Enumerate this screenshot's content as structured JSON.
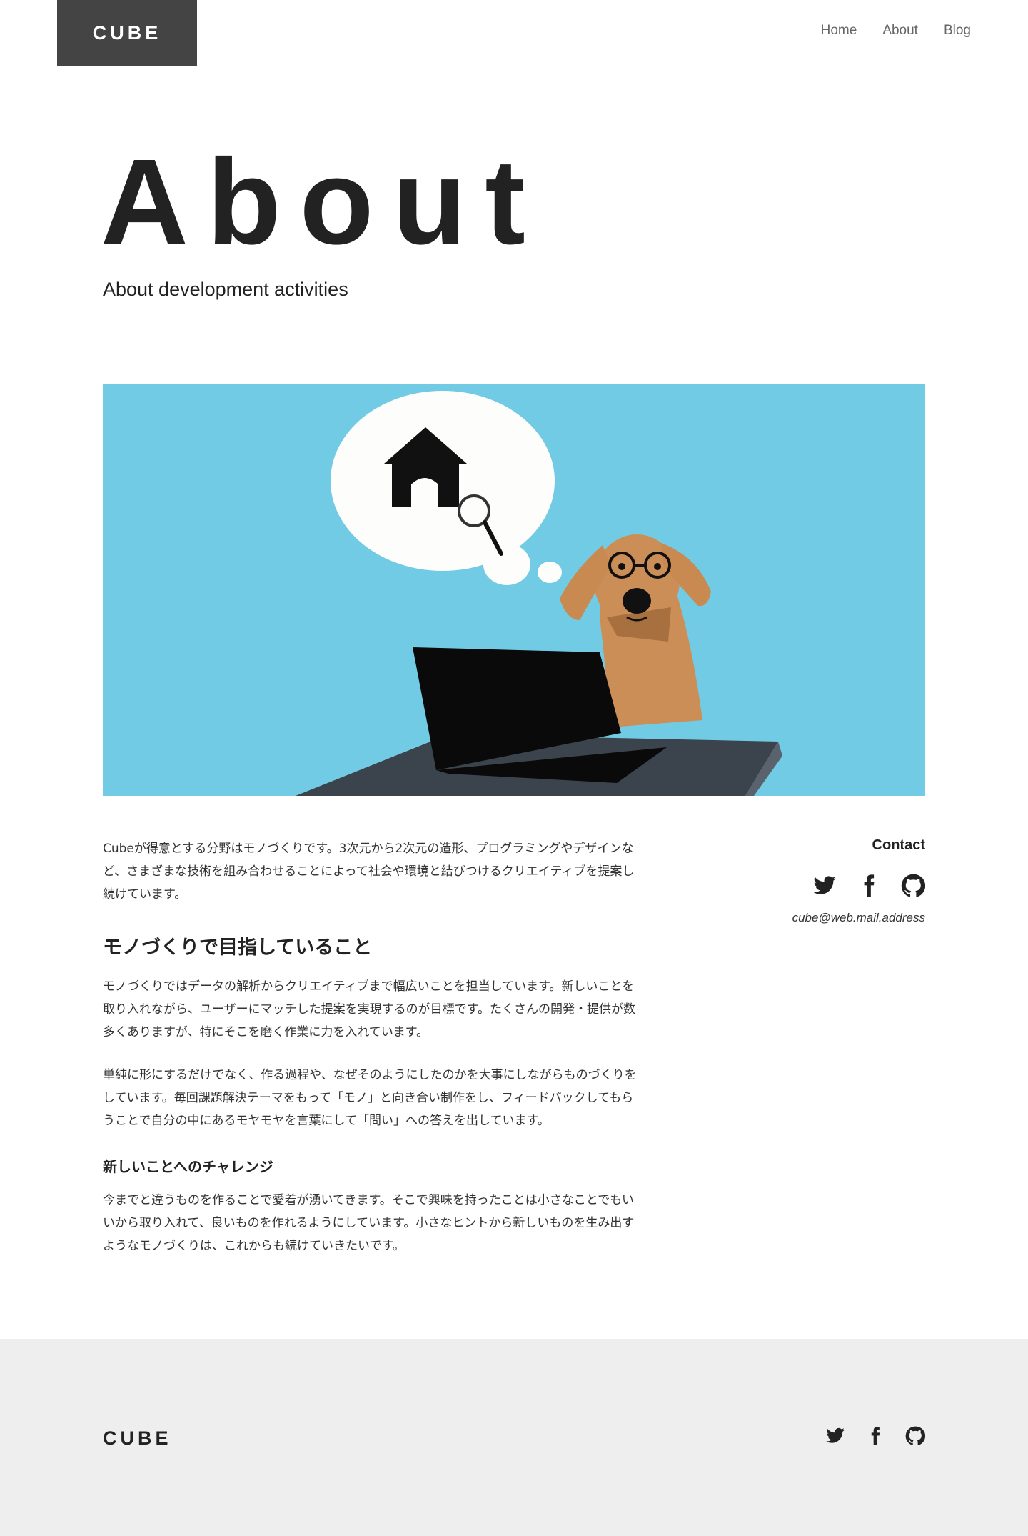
{
  "header": {
    "logo": "CUBE",
    "nav": [
      "Home",
      "About",
      "Blog"
    ]
  },
  "hero": {
    "title": "About",
    "subtitle": "About development activities"
  },
  "content": {
    "intro": "Cubeが得意とする分野はモノづくりです。3次元から2次元の造形、プログラミングやデザインなど、さまざまな技術を組み合わせることによって社会や環境と結びつけるクリエイティブを提案し続けています。",
    "section_heading": "モノづくりで目指していること",
    "section_p1": "モノづくりではデータの解析からクリエイティブまで幅広いことを担当しています。新しいことを取り入れながら、ユーザーにマッチした提案を実現するのが目標です。たくさんの開発・提供が数多くありますが、特にそこを磨く作業に力を入れています。",
    "section_p2": "単純に形にするだけでなく、作る過程や、なぜそのようにしたのかを大事にしながらものづくりをしています。毎回課題解決テーマをもって「モノ」と向き合い制作をし、フィードバックしてもらうことで自分の中にあるモヤモヤを言葉にして「問い」への答えを出しています。",
    "subheading": "新しいことへのチャレンジ",
    "sub_p": "今までと違うものを作ることで愛着が湧いてきます。そこで興味を持ったことは小さなことでもいいから取り入れて、良いものを作れるようにしています。小さなヒントから新しいものを生み出すようなモノづくりは、これからも続けていきたいです。"
  },
  "contact": {
    "title": "Contact",
    "icons": [
      "twitter-icon",
      "facebook-icon",
      "github-icon"
    ],
    "email": "cube@web.mail.address"
  },
  "footer": {
    "logo": "CUBE",
    "icons": [
      "twitter-icon",
      "facebook-icon",
      "github-icon"
    ]
  },
  "colors": {
    "logo_bg": "#444444",
    "hero_bg": "#72cbe4",
    "footer_bg": "#eeeeee",
    "dog": "#cc8e57",
    "desk": "#3b434c"
  }
}
